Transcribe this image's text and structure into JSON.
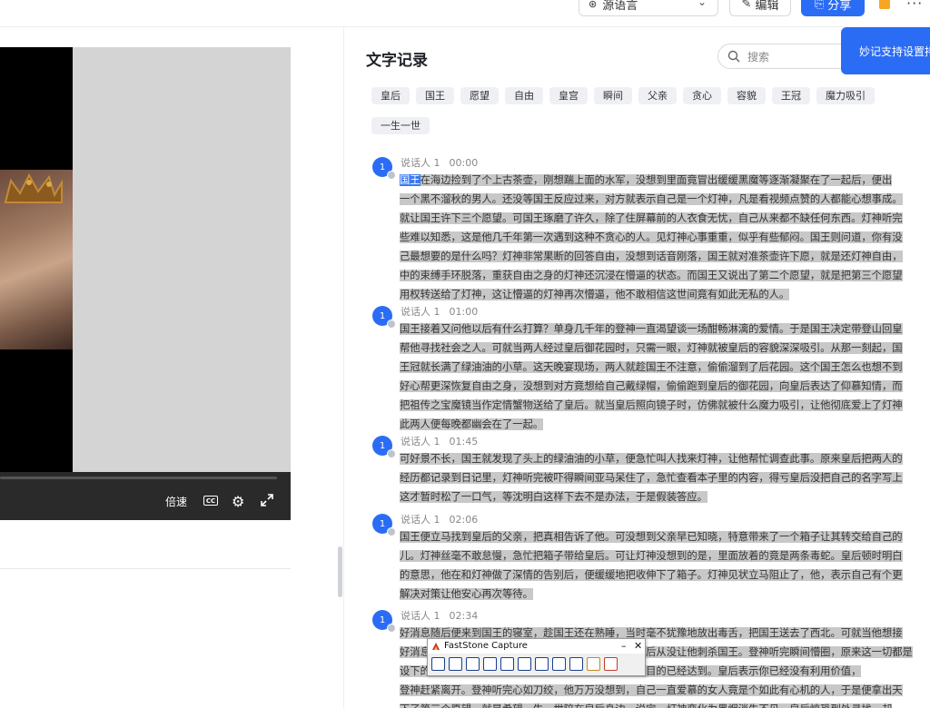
{
  "toolbar": {
    "language_select": "源语言",
    "edit_label": "编辑",
    "share_label": "分享",
    "more": "···"
  },
  "player": {
    "speed_label": "倍速",
    "cc_label": "CC"
  },
  "panel": {
    "title": "文字记录",
    "search_placeholder": "搜索",
    "tooltip": "妙记支持设置持"
  },
  "tags": [
    "皇后",
    "国王",
    "愿望",
    "自由",
    "皇宫",
    "瞬间",
    "父亲",
    "贪心",
    "容貌",
    "王冠",
    "魔力吸引",
    "一生一世"
  ],
  "segments": [
    {
      "avatar": "1",
      "speaker": "说话人 1",
      "time": "00:00",
      "first_word": "国王",
      "lines": [
        "在海边捡到了个上古茶壶，刚想踹上面的水军，没想到里面竟冒出缓缓黑魔等逐渐凝聚在了一起后，便出",
        "一个黑不溜秋的男人。还没等国王反应过来，对方就表示自己是一个灯神，凡是看视频点赞的人都能心想事成。",
        "就让国王许下三个愿望。可国王琢磨了许久，除了住屏幕前的人衣食无忧，自己从来都不缺任何东西。灯神听完",
        "些难以知悉，这是他几千年第一次遇到这种不贪心的人。见灯神心事重重，似乎有些郁闷。国王则问道，你有没",
        "己最想要的是什么吗？灯神非常果断的回答自由，没想到话音刚落，国王就对准茶壶许下愿，就是还灯神自由，",
        "中的束缚手环脱落，重获自由之身的灯神还沉浸在懵逼的状态。而国王又说出了第二个愿望，就是把第三个愿望",
        "用权转送给了灯神，这让懵逼的灯神再次懵逼，他不敢相信这世间竟有如此无私的人。"
      ]
    },
    {
      "avatar": "1",
      "speaker": "说话人 1",
      "time": "01:00",
      "first_word": "",
      "lines": [
        "国王接着又问他以后有什么打算？单身几千年的登神一直渴望谈一场酣畅淋漓的爱情。于是国王决定带登山回皇",
        "帮他寻找社会之人。可就当两人经过皇后御花园时，只需一眼，灯神就被皇后的容貌深深吸引。从那一刻起，国",
        "王冠就长满了绿油油的小草。这天晚宴现场，两人就趁国王不注意，偷偷溜到了后花园。这个国王怎么也想不到",
        "好心帮更深恢复自由之身，没想到对方竟想给自己戴绿帽，偷偷跑到皇后的御花园，向皇后表达了仰慕知情，而",
        "把祖传之宝魔镜当作定情蟹物送给了皇后。就当皇后照向镜子时，仿佛就被什么魔力吸引，让他彻底爱上了灯神",
        "此两人便每晚都幽会在了一起。"
      ]
    },
    {
      "avatar": "1",
      "speaker": "说话人 1",
      "time": "01:45",
      "first_word": "",
      "lines": [
        "可好景不长，国王就发现了头上的绿油油的小草，便急忙叫人找来灯神，让他帮忙调查此事。原来皇后把两人的",
        "经历都记录到日记里，灯神听完被吓得瞬间亚马呆住了，急忙查看本子里的内容，得亏皇后没把自己的名字写上",
        "这才暂时松了一口气，等沈明白这样下去不是办法，于是假装答应。"
      ]
    },
    {
      "avatar": "1",
      "speaker": "说话人 1",
      "time": "02:06",
      "first_word": "",
      "lines": [
        "国王便立马找到皇后的父亲，把真相告诉了他。可没想到父亲早已知晓，特意带来了一个箱子让其转交给自己的",
        "儿。灯神丝毫不敢怠慢，急忙把箱子带给皇后。可让灯神没想到的是，里面放着的竟是两条毒蛇。皇后顿时明白",
        "的意思，他在和灯神做了深情的告别后，便缓缓地把收伸下了箱子。灯神见状立马阻止了，他，表示自己有个更",
        "解决对策让他安心再次等待。"
      ]
    },
    {
      "avatar": "1",
      "speaker": "说话人 1",
      "time": "02:34",
      "first_word": "",
      "lines": [
        "好消息随后便来到国王的寝室，趁国王还在熟睡，当时毫不犹豫地放出毒舌，把国王送去了西北。可就当他想接",
        "好消息告诉皇后时，却发现皇后早已不见踪影，原来皇后从没让他刺杀国王。登神听完瞬间懵圈，原来这一切都是",
        "设下的圈套，皇后从一开始就在利用他除掉国王，现在目的已经达到。皇后表示你已经没有利用价值，",
        "登神赶紧离开。登神听完心如刀绞，他万万没想到，自己一直爱慕的女人竟是个如此有心机的人，于是便拿出天",
        "下了第三个愿望，就是希望一生一世陪在皇后身边。说完，灯神变化为黑烟消失不见，皇后惊恐到处寻找，却"
      ]
    }
  ],
  "faststone": {
    "title": "FastStone Capture",
    "minimize": "–",
    "close": "✕"
  }
}
